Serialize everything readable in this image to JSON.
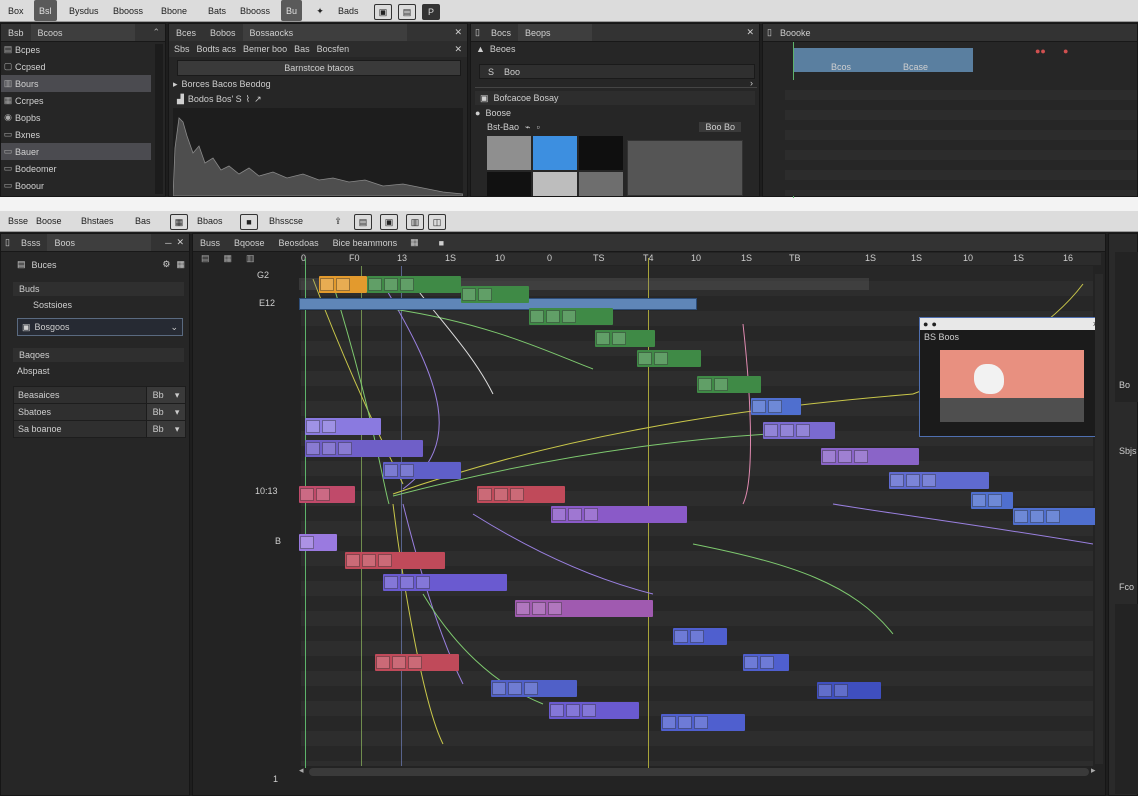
{
  "top_window": {
    "menu": [
      "Box",
      "Bsl",
      "Bysdus",
      "Bbooss",
      "Bbone",
      "Bats",
      "Bbooss",
      "Bu",
      "Bads"
    ],
    "left_panel": {
      "tabs": [
        "Bsb",
        "Bcoos"
      ],
      "items": [
        "Bcpes",
        "Ccpsed",
        "Bours",
        "Ccrpes",
        "Bopbs",
        "Bxnes",
        "Bauer",
        "Bodeomer",
        "Booour"
      ],
      "selected": [
        2,
        6
      ]
    },
    "histogram_panel": {
      "tabs": [
        "Bces",
        "Bobos",
        "Bossaocks"
      ],
      "toolbar": [
        "Sbs",
        "Bodts acs",
        "Bemer boo",
        "Bas",
        "Bocsfen"
      ],
      "button": "Barnstcoe btacos",
      "row1": "Borces Bacos Beodog",
      "row2": "Bodos Bos' S"
    },
    "props_panel": {
      "tabs": [
        "Bocs",
        "Beops"
      ],
      "header": "Beoes",
      "field": "Boo",
      "field_prefix": "S",
      "section": "Bofcacoe Bosay",
      "node_label": "Boose",
      "option": "Bst-Bao",
      "option_field": "Boo Bo"
    },
    "timeline_panel": {
      "title": "Boooke",
      "label1": "Bcos",
      "label2": "Bcase"
    }
  },
  "bottom_window": {
    "menu": [
      "Bsse",
      "Boose",
      "Bhstaes",
      "Bas",
      "Bbaos",
      "Bhsscse"
    ],
    "left_panel": {
      "tabs": [
        "Bsss",
        "Boos"
      ],
      "header": "Buces",
      "section1": "Buds",
      "item1": "Sostsioes",
      "dropdown": "Bosgoos",
      "section2": "Baqoes",
      "label2": "Abspast",
      "props": [
        {
          "label": "Beasaices",
          "value": "Bb"
        },
        {
          "label": "Sbatoes",
          "value": "Bb"
        },
        {
          "label": "Sa boanoe",
          "value": "Bb"
        }
      ]
    },
    "editor": {
      "tabs": [
        "Buss",
        "Bqoose",
        "Beosdoas",
        "Bice beammons"
      ],
      "ruler_ticks": [
        "0",
        "F0",
        "13",
        "1S",
        "10",
        "0",
        "TS",
        "T4",
        "10",
        "1S",
        "TB",
        "1S",
        "1S",
        "10",
        "1S",
        "16"
      ],
      "row_labels": [
        "G2",
        "E12",
        "10:13",
        "B",
        "1"
      ],
      "preview_title": "BS Boos"
    },
    "right_panel": {
      "labels": [
        "Bo",
        "Sbjs",
        "Fco"
      ]
    }
  },
  "colors": {
    "bg_dark": "#1f1f1f",
    "panel": "#262626",
    "accent_blue": "#3d8fe0",
    "node_green": "#3f8a46",
    "node_blue": "#4f5fbf",
    "node_purple": "#7060c0",
    "node_red": "#c04a5a",
    "node_orange": "#e39a2d",
    "wire_yellow": "#c9c74a",
    "playhead": "#a8a43a"
  }
}
